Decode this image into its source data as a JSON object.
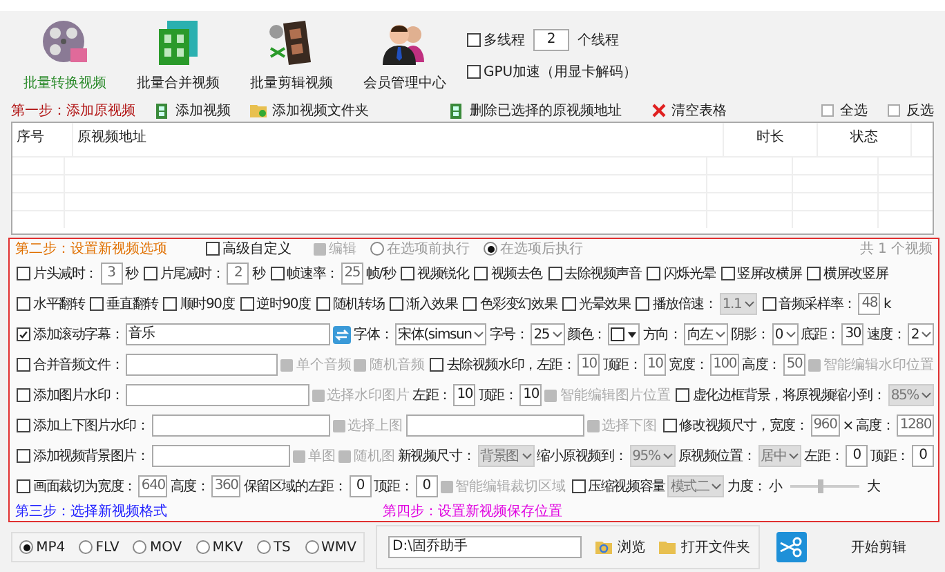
{
  "toolbar": [
    {
      "label": "批量转换视频",
      "selected": true
    },
    {
      "label": "批量合并视频",
      "selected": false
    },
    {
      "label": "批量剪辑视频",
      "selected": false
    },
    {
      "label": "会员管理中心",
      "selected": false
    }
  ],
  "multithread": {
    "label": "多线程",
    "checked": false,
    "count": "2",
    "unit": "个线程"
  },
  "gpu": {
    "label": "GPU加速（用显卡解码）",
    "checked": false
  },
  "step1": {
    "title": "第一步：添加原视频",
    "actions": [
      {
        "label": "添加视频"
      },
      {
        "label": "添加视频文件夹"
      },
      {
        "label": "删除已选择的原视频地址"
      },
      {
        "label": "清空表格"
      }
    ],
    "select_all": "全选",
    "invert": "反选"
  },
  "table": {
    "columns": [
      "序号",
      "原视频地址",
      "时长",
      "状态"
    ]
  },
  "step2": {
    "title": "第二步：设置新视频选项",
    "advanced": {
      "label": "高级自定义",
      "checked": false
    },
    "edit": {
      "label": "编辑",
      "disabled": true
    },
    "radios": [
      {
        "label": "在选项前执行",
        "selected": false,
        "disabled": true
      },
      {
        "label": "在选项后执行",
        "selected": true,
        "disabled": true
      }
    ],
    "count": "共 1 个视频"
  },
  "option_rows": [
    [
      {
        "kind": "check",
        "label": "片头减时：",
        "checked": false
      },
      {
        "kind": "input",
        "value": "3",
        "disabled": true
      },
      {
        "kind": "text",
        "label": "秒"
      },
      {
        "kind": "check",
        "label": "片尾减时：",
        "checked": false
      },
      {
        "kind": "input",
        "value": "2",
        "disabled": true
      },
      {
        "kind": "text",
        "label": "秒"
      },
      {
        "kind": "check",
        "label": "帧速率：",
        "checked": false
      },
      {
        "kind": "input",
        "value": "25",
        "disabled": true
      },
      {
        "kind": "text",
        "label": "帧/秒"
      },
      {
        "kind": "check",
        "label": "视频锐化",
        "checked": false
      },
      {
        "kind": "check",
        "label": "视频去色",
        "checked": false
      },
      {
        "kind": "check",
        "label": "去除视频声音",
        "checked": false
      },
      {
        "kind": "check",
        "label": "闪烁光晕",
        "checked": false
      },
      {
        "kind": "check",
        "label": "竖屏改横屏",
        "checked": false
      },
      {
        "kind": "check",
        "label": "横屏改竖屏",
        "checked": false
      }
    ],
    [
      {
        "kind": "check",
        "label": "水平翻转",
        "checked": false
      },
      {
        "kind": "check",
        "label": "垂直翻转",
        "checked": false
      },
      {
        "kind": "check",
        "label": "顺时90度",
        "checked": false
      },
      {
        "kind": "check",
        "label": "逆时90度",
        "checked": false
      },
      {
        "kind": "check",
        "label": "随机转场",
        "checked": false
      },
      {
        "kind": "check",
        "label": "渐入效果",
        "checked": false
      },
      {
        "kind": "check",
        "label": "色彩变幻效果",
        "checked": false
      },
      {
        "kind": "check",
        "label": "光晕效果",
        "checked": false
      },
      {
        "kind": "check",
        "label": "播放倍速：",
        "checked": false
      },
      {
        "kind": "select",
        "value": "1.1",
        "disabled": true
      },
      {
        "kind": "check",
        "label": "音频采样率：",
        "checked": false
      },
      {
        "kind": "input",
        "value": "48",
        "disabled": true
      },
      {
        "kind": "text",
        "label": "k"
      }
    ],
    [
      {
        "kind": "check",
        "label": "添加滚动字幕：",
        "checked": true
      },
      {
        "kind": "field",
        "value": "音乐"
      },
      {
        "kind": "refresh"
      },
      {
        "kind": "text",
        "label": "字体："
      },
      {
        "kind": "select",
        "value": "宋体(simsun",
        "disabled": false
      },
      {
        "kind": "text",
        "label": "字号："
      },
      {
        "kind": "select",
        "value": "25",
        "disabled": false
      },
      {
        "kind": "text",
        "label": "颜色："
      },
      {
        "kind": "color",
        "color": "#ffffff"
      },
      {
        "kind": "text",
        "label": "方向："
      },
      {
        "kind": "select",
        "value": "向左",
        "disabled": false
      },
      {
        "kind": "text",
        "label": "阴影："
      },
      {
        "kind": "select",
        "value": "0",
        "disabled": false
      },
      {
        "kind": "text",
        "label": "底距："
      },
      {
        "kind": "input",
        "value": "30",
        "disabled": false
      },
      {
        "kind": "text",
        "label": "速度："
      },
      {
        "kind": "select",
        "value": "2",
        "disabled": false
      }
    ],
    [
      {
        "kind": "check",
        "label": "合并音频文件：",
        "checked": false
      },
      {
        "kind": "field"
      },
      {
        "kind": "button",
        "label": "单个音频",
        "disabled": true
      },
      {
        "kind": "button",
        "label": "随机音频",
        "disabled": true
      },
      {
        "kind": "check",
        "label": "去除视频水印，左距：",
        "checked": false
      },
      {
        "kind": "input",
        "value": "10",
        "disabled": true
      },
      {
        "kind": "text",
        "label": "顶距："
      },
      {
        "kind": "input",
        "value": "10",
        "disabled": true
      },
      {
        "kind": "text",
        "label": "宽度："
      },
      {
        "kind": "input",
        "value": "100",
        "disabled": true
      },
      {
        "kind": "text",
        "label": "高度："
      },
      {
        "kind": "input",
        "value": "50",
        "disabled": true
      },
      {
        "kind": "button",
        "label": "智能编辑水印位置",
        "disabled": true
      }
    ],
    [
      {
        "kind": "check",
        "label": "添加图片水印：",
        "checked": false
      },
      {
        "kind": "field"
      },
      {
        "kind": "button",
        "label": "选择水印图片",
        "disabled": true
      },
      {
        "kind": "text",
        "label": "左距："
      },
      {
        "kind": "input",
        "value": "10",
        "disabled": false
      },
      {
        "kind": "text",
        "label": "顶距："
      },
      {
        "kind": "input",
        "value": "10",
        "disabled": false
      },
      {
        "kind": "button",
        "label": "智能编辑图片位置",
        "disabled": true
      },
      {
        "kind": "check",
        "label": "虚化边框背景，将原视频缩小到：",
        "checked": false
      },
      {
        "kind": "select",
        "value": "85%",
        "disabled": true
      }
    ],
    [
      {
        "kind": "check",
        "label": "添加上下图片水印：",
        "checked": false
      },
      {
        "kind": "field"
      },
      {
        "kind": "button",
        "label": "选择上图",
        "disabled": true
      },
      {
        "kind": "field"
      },
      {
        "kind": "button",
        "label": "选择下图",
        "disabled": true
      },
      {
        "kind": "check",
        "label": "修改视频尺寸，宽度：",
        "checked": false
      },
      {
        "kind": "input",
        "value": "960",
        "disabled": true
      },
      {
        "kind": "text",
        "label": "×"
      },
      {
        "kind": "text",
        "label": "高度："
      },
      {
        "kind": "input",
        "value": "1280",
        "disabled": true
      }
    ],
    [
      {
        "kind": "check",
        "label": "添加视频背景图片：",
        "checked": false
      },
      {
        "kind": "field"
      },
      {
        "kind": "button",
        "label": "单图",
        "disabled": true
      },
      {
        "kind": "button",
        "label": "随机图",
        "disabled": true
      },
      {
        "kind": "text",
        "label": "新视频尺寸："
      },
      {
        "kind": "select",
        "value": "背景图",
        "disabled": true
      },
      {
        "kind": "text",
        "label": "缩小原视频到："
      },
      {
        "kind": "select",
        "value": "95%",
        "disabled": true
      },
      {
        "kind": "text",
        "label": "原视频位置："
      },
      {
        "kind": "select",
        "value": "居中",
        "disabled": true
      },
      {
        "kind": "text",
        "label": "左距："
      },
      {
        "kind": "input",
        "value": "0",
        "disabled": false
      },
      {
        "kind": "text",
        "label": "顶距："
      },
      {
        "kind": "input",
        "value": "0",
        "disabled": false
      }
    ],
    [
      {
        "kind": "check",
        "label": "画面裁切为宽度：",
        "checked": false
      },
      {
        "kind": "input",
        "value": "640",
        "disabled": true
      },
      {
        "kind": "text",
        "label": "高度："
      },
      {
        "kind": "input",
        "value": "360",
        "disabled": true
      },
      {
        "kind": "text",
        "label": "保留区域的左距："
      },
      {
        "kind": "input",
        "value": "0",
        "disabled": false
      },
      {
        "kind": "text",
        "label": "顶距："
      },
      {
        "kind": "input",
        "value": "0",
        "disabled": false
      },
      {
        "kind": "button",
        "label": "智能编辑裁切区域",
        "disabled": true
      },
      {
        "kind": "check",
        "label": "压缩视频容量",
        "checked": false
      },
      {
        "kind": "select",
        "value": "模式二",
        "disabled": true
      },
      {
        "kind": "text",
        "label": "力度："
      },
      {
        "kind": "text",
        "label": "小"
      },
      {
        "kind": "slider",
        "level": 0.45
      },
      {
        "kind": "text",
        "label": "大"
      }
    ]
  ],
  "step3": {
    "title": "第三步：选择新视频格式",
    "formats": [
      {
        "label": "MP4",
        "selected": true
      },
      {
        "label": "FLV",
        "selected": false
      },
      {
        "label": "MOV",
        "selected": false
      },
      {
        "label": "MKV",
        "selected": false
      },
      {
        "label": "TS",
        "selected": false
      },
      {
        "label": "WMV",
        "selected": false
      }
    ]
  },
  "step4": {
    "title": "第四步：设置新视频保存位置",
    "path": "D:\\固乔助手",
    "browse": "浏览",
    "open_folder": "打开文件夹"
  },
  "start": "开始剪辑"
}
